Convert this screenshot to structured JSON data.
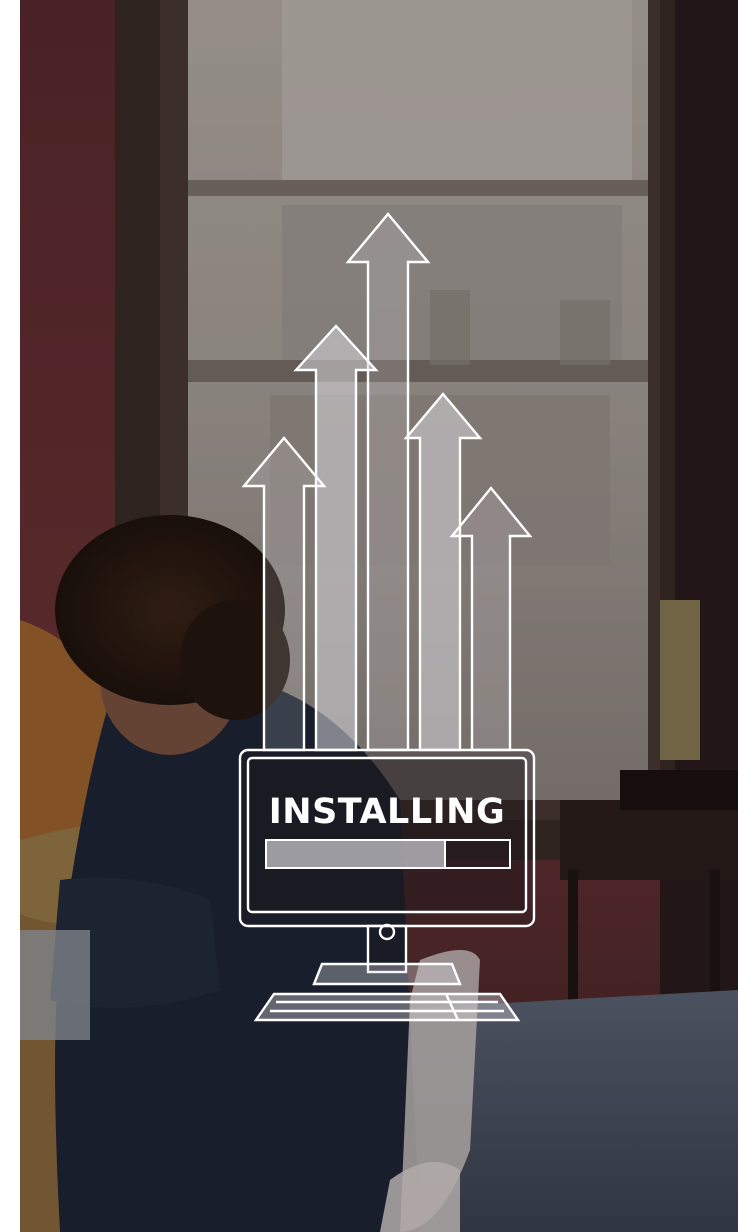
{
  "installer": {
    "status_label": "INSTALLING",
    "progress": 0.74
  },
  "illustration": {
    "icon": "monitor-with-upload-arrows-icon",
    "stroke_color": "#ffffff"
  },
  "background": {
    "description_icon": "office-photo"
  }
}
